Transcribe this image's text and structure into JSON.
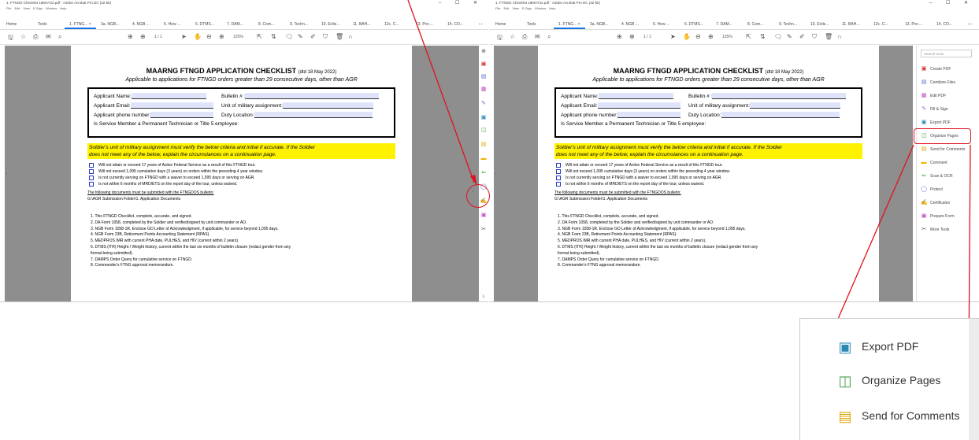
{
  "titlebar": {
    "title": "1. FTNGD Checklist 18MAY22.pdf - Adobe Acrobat Pro DC (32-bit)",
    "controls": "–  ☐  ✕"
  },
  "menu": [
    "File",
    "Edit",
    "View",
    "E-Sign",
    "Window",
    "Help"
  ],
  "tabs": [
    "Home",
    "Tools",
    "1. FTNG...  ×",
    "3a. NGB...",
    "4. NGB ...",
    "5. How ...",
    "6. DTMS...",
    "7. DAM...",
    "8. Com...",
    "9. Techn...",
    "10. Enlis...",
    "11. BAH...",
    "12c. C...",
    "13. Pre-...",
    "14. CO...",
    "‹  ›"
  ],
  "toolbar": {
    "page_value": "1",
    "page_total": "/ 1",
    "zoom": "125%"
  },
  "doc": {
    "title": "MAARNG FTNGD APPLICATION CHECKLIST",
    "title_date": "(dtd 18 May 2022)",
    "subtitle": "Applicable to applications for FTNGD orders greater than 29 consecutive days, other than AGR",
    "applicant_name": "Applicant Name:",
    "bulletin": "Bulletin # :",
    "applicant_email": "Applicant Email:",
    "unit": "Unit of military assignment:",
    "phone": "Applicant phone number:",
    "duty": "Duty Location:",
    "technician": "Is Service Member a Permanent Technician or Title 5 employee:",
    "yellow_line1": "Soldier's unit of military assignment must verify the below criteria and initial if accurate. If the Soldier",
    "yellow_line2": "does not meet any of the below, explain the circumstances on a continuation page.",
    "checks": [
      "Will not attain or exceed 17 years of Active Federal Service as a result of this FTNGD tour.",
      "Will not exceed 1,095 cumulative days (3 years) on orders within the preceding 4 year window.",
      "Is not currently serving on FTNGD with a waiver to exceed 1,095 days or serving on AGR.",
      "Is not within 6 months of MRD/ETS on the report day of the tour, unless waived."
    ],
    "following": "The following documents must be submitted with the FTNGDOS bulletin:",
    "folder": "G:\\AGR Submission Folder\\1. Application Documents",
    "items": [
      "1.  This FTNGD Checklist, complete, accurate, and signed.",
      "2.  DA Form 1058, completed by the Soldier and verified/signed by unit commander or AO.",
      "3.  NGB Form 1058-1R. Enclose GO Letter of Acknowledgment, if applicable, for service beyond 1,095 days.",
      "4.  NGB Form 23B, Retirement Points Accounting Statement (RPAS).",
      "5.  MEDPROS IMR with current PHA date, PULHES, and HIV (current within 2 years).",
      "6.  DTMS (ITR) Height / Weight history, current within the last six months of bulletin closure (redact gender from any",
      "      format being submitted).",
      "7.  DAMPS Order Query for cumulative service on FTNGD.",
      "8.  Commander's FTNG approval memorandum."
    ]
  },
  "right_panel": {
    "search_placeholder": "Search tools",
    "items": [
      "Create PDF",
      "Combine Files",
      "Edit PDF",
      "Fill & Sign",
      "Export PDF",
      "Organize Pages",
      "Send for Comments",
      "Comment",
      "Scan & OCR",
      "Protect",
      "Certificates",
      "Prepare Form",
      "More Tools"
    ]
  },
  "zoom": {
    "items": [
      "Export PDF",
      "Organize Pages",
      "Send for Comments"
    ]
  },
  "colors": {
    "highlight": "#e0121f",
    "accent": "#1473e6",
    "yellow": "#fff200",
    "field": "#dfe4fb"
  }
}
